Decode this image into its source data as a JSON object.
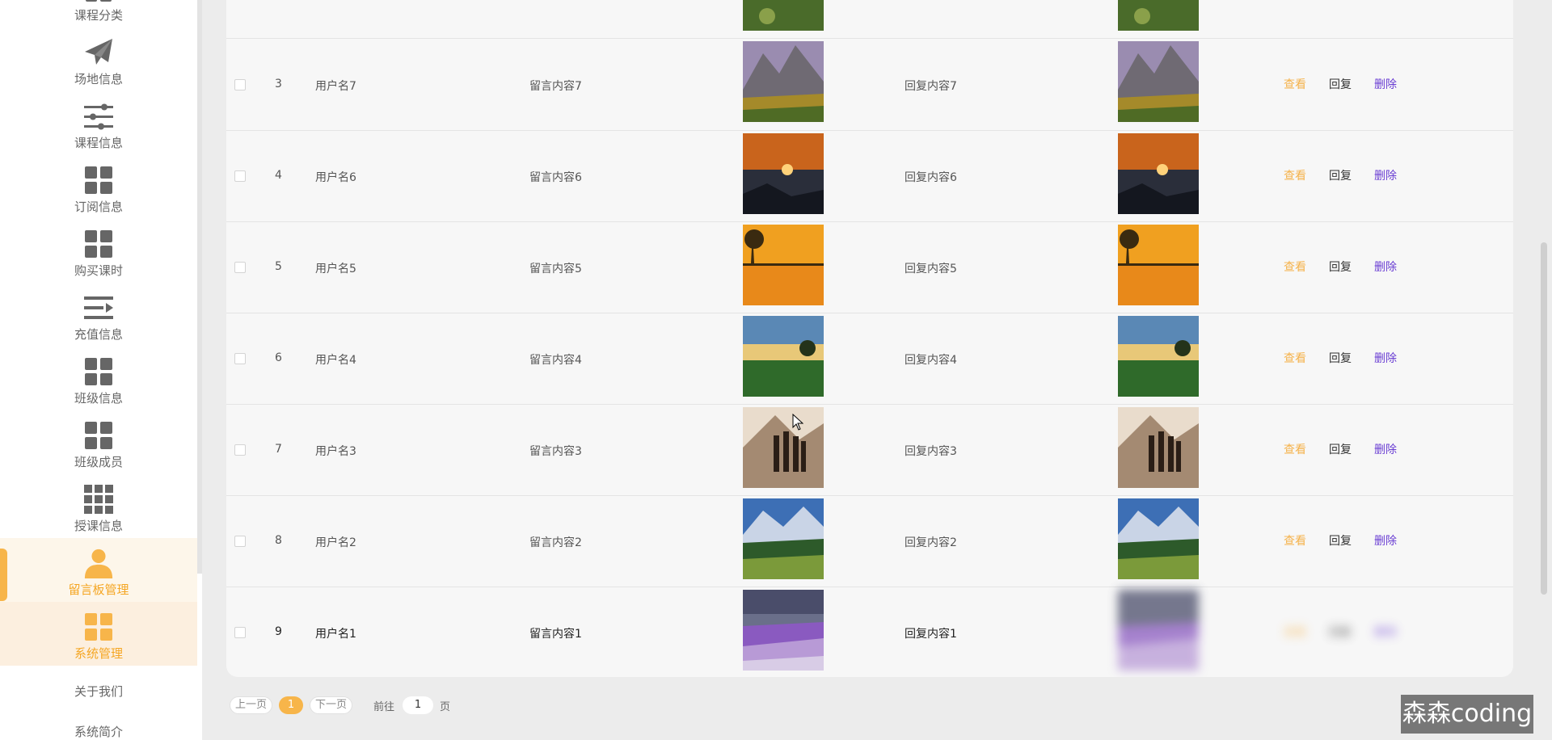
{
  "sidebar": {
    "items": [
      {
        "label": "课程分类",
        "icon": "grid-icon"
      },
      {
        "label": "场地信息",
        "icon": "paper-plane-icon"
      },
      {
        "label": "课程信息",
        "icon": "sliders-icon"
      },
      {
        "label": "订阅信息",
        "icon": "grid-icon"
      },
      {
        "label": "购买课时",
        "icon": "grid-icon"
      },
      {
        "label": "充值信息",
        "icon": "list-icon"
      },
      {
        "label": "班级信息",
        "icon": "grid-icon"
      },
      {
        "label": "班级成员",
        "icon": "grid-icon"
      },
      {
        "label": "授课信息",
        "icon": "apps-icon"
      },
      {
        "label": "留言板管理",
        "icon": "user-icon"
      },
      {
        "label": "系统管理",
        "icon": "grid-icon"
      }
    ],
    "sub_items": [
      "关于我们",
      "系统简介"
    ]
  },
  "table": {
    "rows": [
      {
        "index": "3",
        "username": "用户名7",
        "message": "留言内容7",
        "reply": "回复内容7",
        "image": "mountain-autumn"
      },
      {
        "index": "4",
        "username": "用户名6",
        "message": "留言内容6",
        "reply": "回复内容6",
        "image": "sunset-sea"
      },
      {
        "index": "5",
        "username": "用户名5",
        "message": "留言内容5",
        "reply": "回复内容5",
        "image": "sunset-tree"
      },
      {
        "index": "6",
        "username": "用户名4",
        "message": "留言内容4",
        "reply": "回复内容4",
        "image": "field-tree"
      },
      {
        "index": "7",
        "username": "用户名3",
        "message": "留言内容3",
        "reply": "回复内容3",
        "image": "people-mountain"
      },
      {
        "index": "8",
        "username": "用户名2",
        "message": "留言内容2",
        "reply": "回复内容2",
        "image": "alps-meadow"
      },
      {
        "index": "9",
        "username": "用户名1",
        "message": "留言内容1",
        "reply": "回复内容1",
        "image": "lavender"
      }
    ],
    "actions": {
      "view": "查看",
      "reply": "回复",
      "delete": "删除"
    }
  },
  "pagination": {
    "prev": "上一页",
    "current": "1",
    "next": "下一页",
    "goto_prefix": "前往",
    "goto_value": "1",
    "goto_suffix": "页"
  },
  "watermark": "森森coding",
  "colors": {
    "accent": "#f5a623",
    "view": "#f5b24a",
    "delete": "#6a3ed3"
  }
}
